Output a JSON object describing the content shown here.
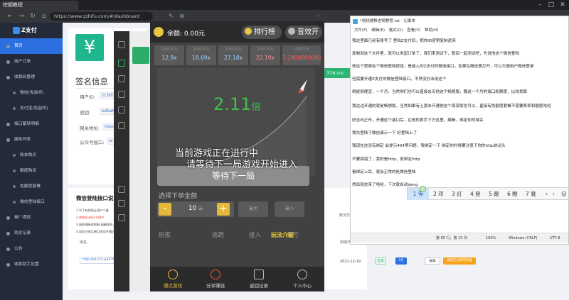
{
  "browser": {
    "tab_title": "挖掘教程",
    "address": "https://www.zzhifu.com/#/dashboard"
  },
  "sidebar": {
    "brand": "Z支付",
    "items": [
      {
        "label": "首页",
        "active": true,
        "sub": false
      },
      {
        "label": "商户订单",
        "active": false,
        "sub": false
      },
      {
        "label": "收款码管理",
        "active": false,
        "sub": false
      },
      {
        "label": "微信(免监听)",
        "active": false,
        "sub": true
      },
      {
        "label": "支付宝(免监听)",
        "active": false,
        "sub": true
      },
      {
        "label": "接口繁琐明细",
        "active": false,
        "sub": false
      },
      {
        "label": "服务列表",
        "active": false,
        "sub": false
      },
      {
        "label": "账本购买",
        "active": false,
        "sub": true
      },
      {
        "label": "额度购买",
        "active": false,
        "sub": true
      },
      {
        "label": "免额度套餐",
        "active": false,
        "sub": true
      },
      {
        "label": "微信登陆接口",
        "active": false,
        "sub": true
      },
      {
        "label": "推广提现",
        "active": false,
        "sub": false
      },
      {
        "label": "购买记录",
        "active": false,
        "sub": false
      },
      {
        "label": "公告",
        "active": false,
        "sub": false
      },
      {
        "label": "收款助手设置",
        "active": false,
        "sub": false
      }
    ]
  },
  "sign_info": {
    "title": "签名信息",
    "user_id_label": "用户ID:",
    "user_id_value": "21365783",
    "key_label": "密钥:",
    "key_value": "tuEkaMFf1",
    "gateway_label": "网关地址:",
    "gateway_value": "https",
    "public_label": "公众号接口:",
    "public_value": "re"
  },
  "wechat_login": {
    "title": "微信登陆接口说",
    "notes": [
      "1.为了有效防止用户二维",
      "2.先购买ubk2.0用户",
      "3.因前端接收限制,请确保先上链以后,微信登陆后接口",
      "4.如非已购买接口测试开通后,开通账本搭建的使用情形不多"
    ],
    "table_headers": [
      "域名",
      "到期日期",
      "状态",
      "域名状态\n(点击接口)",
      "操作"
    ],
    "row": {
      "domain": "http://kd.c11-p4376.cn/",
      "date": "2021-12-19",
      "status": "正常",
      "state_btn": "5元",
      "edit": "编辑",
      "renew": "续费正式使用功能"
    },
    "side_text": "致法交(链"
  },
  "green_tag": "376.cn/",
  "game": {
    "balance_label": "余额: 0.00元",
    "ranking": "排行榜",
    "sound": "音效开",
    "history": [
      {
        "id": "199703",
        "mult": "12.9x",
        "color": "#9fd3ff"
      },
      {
        "id": "199702",
        "mult": "18.69x",
        "color": "#9fd3ff"
      },
      {
        "id": "199704",
        "mult": "27.18x",
        "color": "#9fd3ff"
      },
      {
        "id": "199704",
        "mult": "22.19x",
        "color": "#ff8fa3"
      },
      {
        "id": "199705",
        "mult": "3.2800000000",
        "color": "#ff5a5a"
      }
    ],
    "multiplier": "2.11",
    "multiplier_unit": "倍",
    "wait_line1": "当前游戏正在进行中",
    "wait_line2": "请等待下一局游戏开始进入",
    "wait_button": "等待下一局",
    "bet_label": "选择下单金额",
    "minus": "-",
    "plus": "+",
    "bet_value": "10",
    "bet_unit": "元",
    "quick1": "最大",
    "quick2": "最小",
    "columns": [
      "玩家",
      "逃跑",
      "投入",
      "盈亏"
    ],
    "sticker": "玩法介绍",
    "nav": [
      {
        "label": "爆点游戏",
        "active": true
      },
      {
        "label": "分享赚钱",
        "active": false
      },
      {
        "label": "返回记录",
        "active": false
      },
      {
        "label": "个人中心",
        "active": false
      }
    ]
  },
  "notepad": {
    "title": "*视频建群进销教程.txt - 记事本",
    "menu": [
      "文件(F)",
      "编辑(E)",
      "格式(O)",
      "查看(V)",
      "帮助(H)"
    ],
    "lines": [
      "我这里面已经有账号了 登陆Z支付后，把你ID密钥复制进来",
      "复制到这个文件里，就可以发起订单了，我们来测试下，稍后一起测试吧，先说他这个微信登陆",
      "他这个里面有个微信登陆按钮，是接入的Z支付的微信接口，如果在微信里打开，可以方便用户微信登录",
      "但需要开通Z支付的微信登陆接口，不然没办法用这个",
      "倒是很便宜，一个月，当然你们也可以直接去买他这个畅想版，赠送一个月的接口和额度，比较划算",
      "我这边开通的就是畅想版，当然如果有土豪去开通他这个尊享版也可以，直接有免额度套餐不需要费率和额度哈哈",
      "好吉问正传，开通这个接口后，在他的首页下方这里，编辑，绑定你的域名",
      "我先登陆下微信演示一下  好登陆上了",
      "我现在这没有绑定  会提示404等问题，我绑定一下  绑定的时候要注意下你的http协议头",
      "不要搞错了，我的是http，就绑定http",
      "看绑定上后，就会正常的处微信登陆",
      "然后就进来了哈哈，下次就自动deng"
    ],
    "ime_candidates": [
      "1 等",
      "2 邓",
      "3 灯",
      "4 登",
      "5 蹬",
      "6 瞪",
      "7 凳"
    ],
    "status": {
      "pos": "第 65 行，第 15 列",
      "zoom": "100%",
      "eol": "Windows (CRLF)",
      "enc": "UTF-8"
    }
  }
}
